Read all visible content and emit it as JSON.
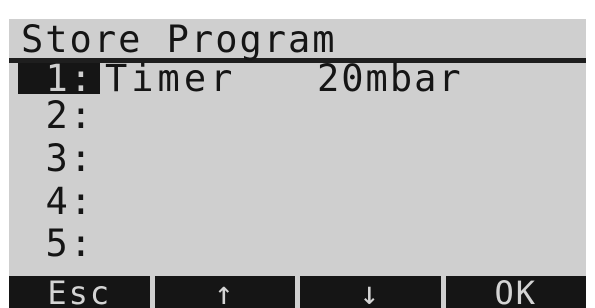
{
  "title": "Store Program",
  "slots": [
    {
      "number": "1:",
      "name": "Timer",
      "value": "20mbar"
    },
    {
      "number": "2:",
      "name": "",
      "value": ""
    },
    {
      "number": "3:",
      "name": "",
      "value": ""
    },
    {
      "number": "4:",
      "name": "",
      "value": ""
    },
    {
      "number": "5:",
      "name": "",
      "value": ""
    }
  ],
  "selected_slot": "1:",
  "softkeys": {
    "esc": "Esc",
    "up": "↑",
    "down": "↓",
    "ok": "OK"
  },
  "colors": {
    "lcd_background": "#cfcfcf",
    "pixel_dark": "#151515"
  }
}
